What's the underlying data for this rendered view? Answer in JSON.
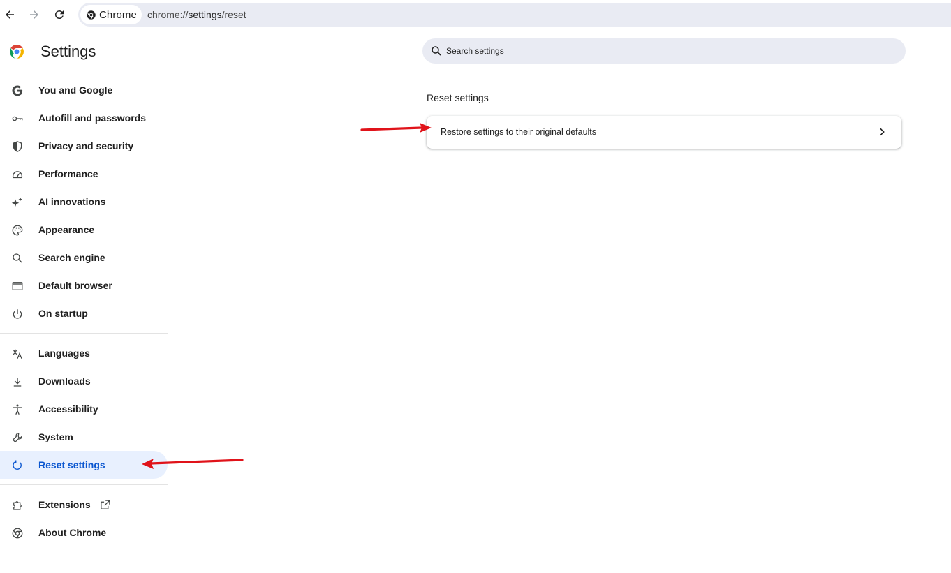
{
  "browser": {
    "chip_label": "Chrome",
    "url_prefix": "chrome://",
    "url_host": "settings",
    "url_path": "/reset"
  },
  "app": {
    "title": "Settings"
  },
  "sidebar": {
    "items": [
      {
        "label": "You and Google",
        "icon": "google-g-icon"
      },
      {
        "label": "Autofill and passwords",
        "icon": "key-icon"
      },
      {
        "label": "Privacy and security",
        "icon": "shield-icon"
      },
      {
        "label": "Performance",
        "icon": "speedometer-icon"
      },
      {
        "label": "AI innovations",
        "icon": "sparkle-icon"
      },
      {
        "label": "Appearance",
        "icon": "palette-icon"
      },
      {
        "label": "Search engine",
        "icon": "search-icon"
      },
      {
        "label": "Default browser",
        "icon": "browser-window-icon"
      },
      {
        "label": "On startup",
        "icon": "power-icon"
      },
      {
        "label": "Languages",
        "icon": "translate-icon"
      },
      {
        "label": "Downloads",
        "icon": "download-icon"
      },
      {
        "label": "Accessibility",
        "icon": "accessibility-icon"
      },
      {
        "label": "System",
        "icon": "wrench-icon"
      },
      {
        "label": "Reset settings",
        "icon": "reset-icon",
        "active": true
      },
      {
        "label": "Extensions",
        "icon": "puzzle-icon"
      },
      {
        "label": "About Chrome",
        "icon": "chrome-icon"
      }
    ]
  },
  "search": {
    "placeholder": "Search settings"
  },
  "main": {
    "section_title": "Reset settings",
    "rows": [
      {
        "label": "Restore settings to their original defaults"
      }
    ]
  },
  "colors": {
    "accent": "#0b57d0",
    "active_bg": "#e8f0fe",
    "annotation_arrow": "#e0131a"
  }
}
